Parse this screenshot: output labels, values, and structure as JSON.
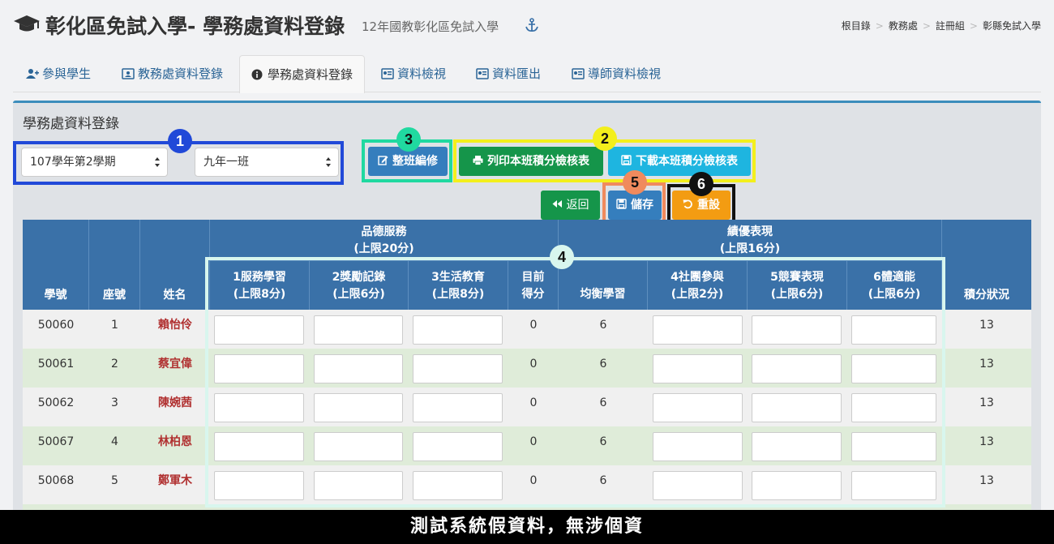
{
  "header": {
    "title": "彰化區免試入學- 學務處資料登錄",
    "subtitle": "12年國教彰化區免試入學",
    "breadcrumb": [
      "根目錄",
      "教務處",
      "註冊組",
      "彰縣免試入學"
    ]
  },
  "tabs": [
    {
      "label": "參與學生",
      "icon": "user-plus-icon",
      "active": false
    },
    {
      "label": "教務處資料登錄",
      "icon": "id-card-icon",
      "active": false
    },
    {
      "label": "學務處資料登錄",
      "icon": "info-circle-icon",
      "active": true
    },
    {
      "label": "資料檢視",
      "icon": "id-card-icon",
      "active": false
    },
    {
      "label": "資料匯出",
      "icon": "id-card-icon",
      "active": false
    },
    {
      "label": "導師資料檢視",
      "icon": "id-card-icon",
      "active": false
    }
  ],
  "panel": {
    "title": "學務處資料登錄",
    "semester_select": "107學年第2學期",
    "class_select": "九年一班"
  },
  "buttons": {
    "edit_class": "整班編修",
    "print_sheet": "列印本班積分檢核表",
    "download_sheet": "下載本班積分檢核表",
    "back": "返回",
    "save": "儲存",
    "reset": "重設"
  },
  "badges": [
    "1",
    "2",
    "3",
    "4",
    "5",
    "6"
  ],
  "colors": {
    "header_blue": "#3a71a8",
    "btn_primary": "#357ebd",
    "btn_success": "#15954a",
    "btn_info": "#1eb5e0",
    "btn_warning": "#f39c12",
    "hl_blue": "#2149d8",
    "hl_yellow": "#f3ef1c",
    "hl_green": "#20d9a0",
    "hl_salmon": "#f08a5d",
    "hl_black": "#111111",
    "hl_light": "#d8f6ee"
  },
  "table": {
    "group_headers": {
      "service": {
        "line1": "品德服務",
        "line2": "(上限20分)"
      },
      "excellence": {
        "line1": "績優表現",
        "line2": "(上限16分)"
      }
    },
    "columns": {
      "student_id": "學號",
      "seat": "座號",
      "name": "姓名",
      "c1": {
        "line1": "1服務學習",
        "line2": "(上限8分)"
      },
      "c2": {
        "line1": "2獎勵記錄",
        "line2": "(上限6分)"
      },
      "c3": {
        "line1": "3生活教育",
        "line2": "(上限8分)"
      },
      "current": {
        "line1": "目前",
        "line2": "得分"
      },
      "balance": "均衡學習",
      "c4": {
        "line1": "4社團參與",
        "line2": "(上限2分)"
      },
      "c5": {
        "line1": "5競賽表現",
        "line2": "(上限6分)"
      },
      "c6": {
        "line1": "6體適能",
        "line2": "(上限6分)"
      },
      "status": "積分狀況"
    },
    "rows": [
      {
        "id": "50060",
        "seat": "1",
        "name": "賴怡伶",
        "current": "0",
        "balance": "6",
        "status": "13"
      },
      {
        "id": "50061",
        "seat": "2",
        "name": "蔡宜偉",
        "current": "0",
        "balance": "6",
        "status": "13"
      },
      {
        "id": "50062",
        "seat": "3",
        "name": "陳婉茜",
        "current": "0",
        "balance": "6",
        "status": "13"
      },
      {
        "id": "50067",
        "seat": "4",
        "name": "林柏恩",
        "current": "0",
        "balance": "6",
        "status": "13"
      },
      {
        "id": "50068",
        "seat": "5",
        "name": "鄭軍木",
        "current": "0",
        "balance": "6",
        "status": "13"
      }
    ]
  },
  "footer": "測試系統假資料，無涉個資"
}
